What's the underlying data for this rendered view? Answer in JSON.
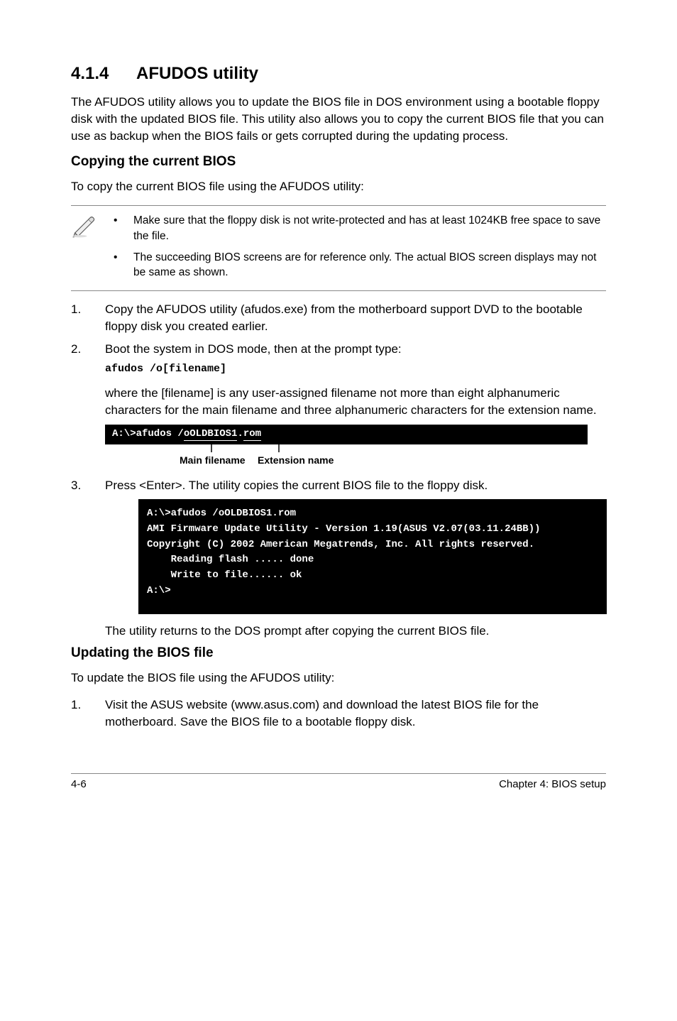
{
  "section": {
    "number": "4.1.4",
    "title": "AFUDOS utility"
  },
  "intro": "The AFUDOS utility allows you to update the BIOS file in DOS environment using a bootable floppy disk with the updated BIOS file. This utility also allows you to copy the current BIOS file that you can use as backup when the BIOS fails or gets corrupted during the updating process.",
  "copy_heading": "Copying the current BIOS",
  "copy_intro": "To copy the current BIOS file using the AFUDOS utility:",
  "notes": [
    "Make sure that the floppy disk is not write-protected and has at least 1024KB free space to save the file.",
    "The succeeding BIOS screens are for reference only. The actual BIOS screen displays may not be same as shown."
  ],
  "steps_copy": [
    {
      "n": "1.",
      "text": "Copy the AFUDOS utility (afudos.exe) from the motherboard support DVD to the bootable floppy disk you created earlier."
    },
    {
      "n": "2.",
      "text": "Boot the system in DOS mode, then at the prompt type:",
      "cmd": "afudos /o[filename]"
    }
  ],
  "where_text": "where the [filename] is any user-assigned filename not more than eight alphanumeric characters  for the main filename and three alphanumeric characters for the extension name.",
  "terminal1": {
    "prefix": "A:\\>afudos /",
    "part1": "oOLDBIOS1",
    "dot": ".",
    "part2": "rom"
  },
  "legend1": "Main filename",
  "legend2": "Extension name",
  "step3": {
    "n": "3.",
    "text": "Press <Enter>. The utility copies the current BIOS file to the floppy disk."
  },
  "terminal2": "A:\\>afudos /oOLDBIOS1.rom\nAMI Firmware Update Utility - Version 1.19(ASUS V2.07(03.11.24BB))\nCopyright (C) 2002 American Megatrends, Inc. All rights reserved.\n    Reading flash ..... done\n    Write to file...... ok\nA:\\>",
  "copy_outro": "The utility returns to the DOS prompt after copying the current BIOS file.",
  "update_heading": "Updating the BIOS file",
  "update_intro": "To update the BIOS file using the AFUDOS utility:",
  "steps_update": [
    {
      "n": "1.",
      "text": "Visit the ASUS website (www.asus.com) and download the latest BIOS file for the motherboard. Save the BIOS file to a bootable floppy disk."
    }
  ],
  "footer_left": "4-6",
  "footer_right": "Chapter 4: BIOS setup"
}
